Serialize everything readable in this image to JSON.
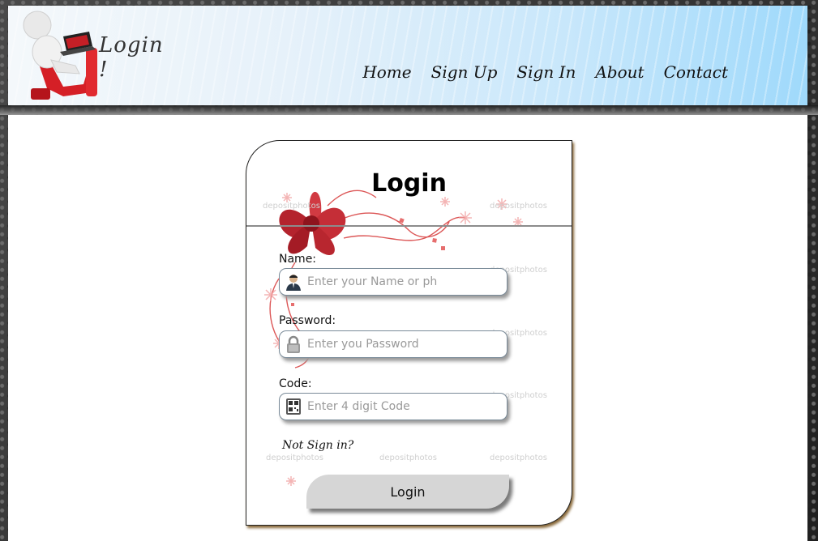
{
  "header": {
    "logo_text": "Login !",
    "nav": [
      {
        "label": "Home"
      },
      {
        "label": "Sign Up"
      },
      {
        "label": "Sign In"
      },
      {
        "label": "About"
      },
      {
        "label": "Contact"
      }
    ]
  },
  "form": {
    "title": "Login",
    "name_label": "Name:",
    "name_placeholder": "Enter your Name or ph",
    "password_label": "Password:",
    "password_placeholder": "Enter you Password",
    "code_label": "Code:",
    "code_placeholder": "Enter 4 digit Code",
    "not_signed_in": "Not Sign in?",
    "login_button": "Login",
    "watermark": "depositphotos"
  },
  "icons": {
    "user": "user-icon",
    "lock": "lock-icon",
    "qr": "qr-code-icon",
    "bow": "red-bow-decoration",
    "logo": "person-at-laptop-logo"
  },
  "colors": {
    "accent_red": "#c8102e",
    "header_blue": "#9fd9fb",
    "button_gray": "#d6d6d6"
  }
}
